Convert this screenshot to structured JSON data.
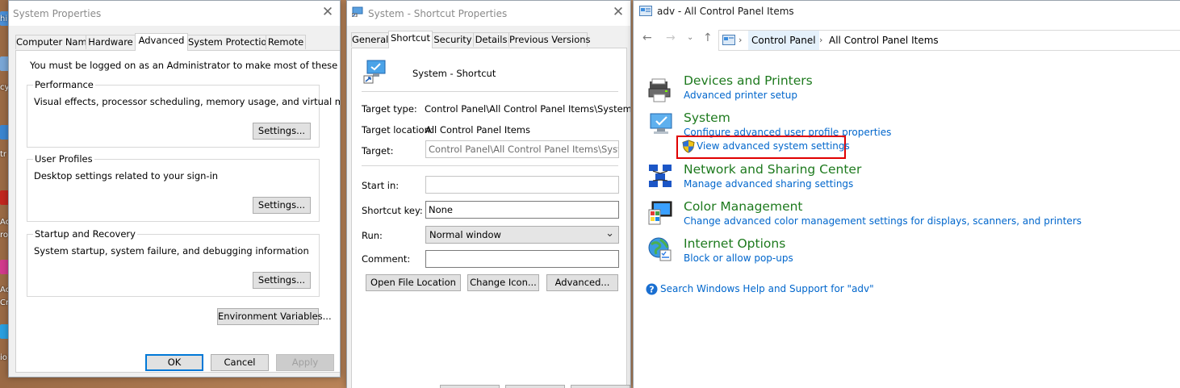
{
  "desktop": {
    "left_labels": [
      "hi",
      "cy",
      "tr",
      "Ac",
      "ro",
      "Ac",
      "Cre",
      "io"
    ]
  },
  "system_properties": {
    "title": "System Properties",
    "close_glyph": "✕",
    "tabs": [
      "Computer Name",
      "Hardware",
      "Advanced",
      "System Protection",
      "Remote"
    ],
    "active_tab": "Advanced",
    "admin_note": "You must be logged on as an Administrator to make most of these changes.",
    "performance": {
      "label": "Performance",
      "desc": "Visual effects, processor scheduling, memory usage, and virtual memory",
      "button": "Settings..."
    },
    "user_profiles": {
      "label": "User Profiles",
      "desc": "Desktop settings related to your sign-in",
      "button": "Settings..."
    },
    "startup_recovery": {
      "label": "Startup and Recovery",
      "desc": "System startup, system failure, and debugging information",
      "button": "Settings..."
    },
    "env_button": "Environment Variables...",
    "ok": "OK",
    "cancel": "Cancel",
    "apply": "Apply"
  },
  "shortcut_properties": {
    "title": "System - Shortcut Properties",
    "close_glyph": "✕",
    "tabs": [
      "General",
      "Shortcut",
      "Security",
      "Details",
      "Previous Versions"
    ],
    "active_tab": "Shortcut",
    "name": "System - Shortcut",
    "target_type_label": "Target type:",
    "target_type_value": "Control Panel\\All Control Panel Items\\System",
    "target_location_label": "Target location:",
    "target_location_value": "All Control Panel Items",
    "target_label": "Target:",
    "target_value": "Control Panel\\All Control Panel Items\\System",
    "start_in_label": "Start in:",
    "start_in_value": "",
    "shortcut_key_label": "Shortcut key:",
    "shortcut_key_value": "None",
    "run_label": "Run:",
    "run_value": "Normal window",
    "comment_label": "Comment:",
    "comment_value": "",
    "open_location_button": "Open File Location",
    "change_icon_button": "Change Icon...",
    "advanced_button": "Advanced..."
  },
  "control_panel": {
    "title": "adv - All Control Panel Items",
    "breadcrumb": [
      "Control Panel",
      "All Control Panel Items"
    ],
    "items": [
      {
        "heading": "Devices and Printers",
        "links": [
          "Advanced printer setup"
        ],
        "icon": "printer-icon"
      },
      {
        "heading": "System",
        "links": [
          "Configure advanced user profile properties",
          "View advanced system settings"
        ],
        "icon": "system-icon"
      },
      {
        "heading": "Network and Sharing Center",
        "links": [
          "Manage advanced sharing settings"
        ],
        "icon": "network-icon"
      },
      {
        "heading": "Color Management",
        "links": [
          "Change advanced color management settings for displays, scanners, and printers"
        ],
        "icon": "color-management-icon"
      },
      {
        "heading": "Internet Options",
        "links": [
          "Block or allow pop-ups"
        ],
        "icon": "internet-options-icon"
      }
    ],
    "help_link": "Search Windows Help and Support for \"adv\"",
    "highlight_color": "#e00000",
    "heading_color": "#1e7a1e",
    "link_color": "#0066cc"
  }
}
